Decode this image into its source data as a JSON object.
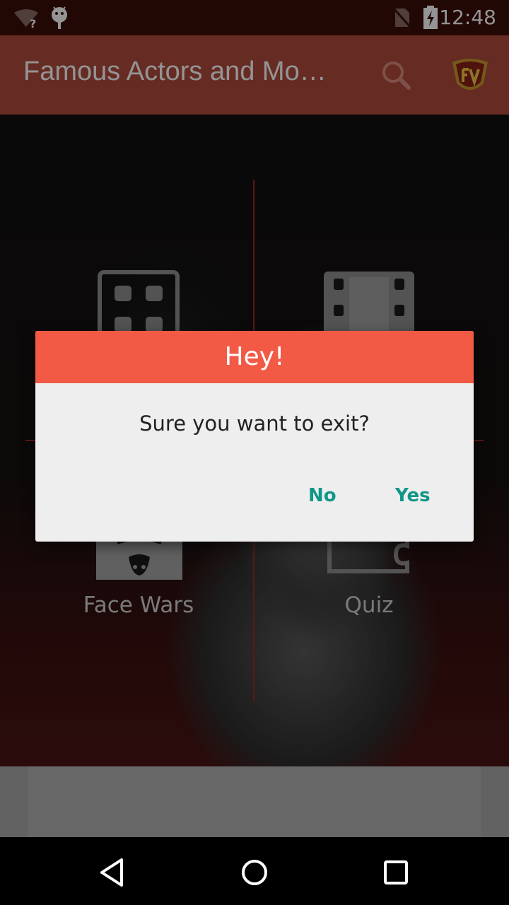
{
  "status_bar": {
    "time": "12:48",
    "icons": [
      "wifi-unknown-icon",
      "android-debug-icon",
      "no-sim-icon",
      "battery-charging-icon"
    ]
  },
  "app_bar": {
    "title": "Famous Actors and Mo…",
    "search_icon": "search-icon",
    "logo_icon": "fv-logo-icon"
  },
  "tiles": [
    {
      "label": "",
      "icon": "grid-dots-icon"
    },
    {
      "label": "",
      "icon": "film-strip-icon"
    },
    {
      "label": "Face Wars",
      "icon": "face-icon"
    },
    {
      "label": "Quiz",
      "icon": "puzzle-icon"
    }
  ],
  "dialog": {
    "title": "Hey!",
    "message": "Sure you want to exit?",
    "negative": "No",
    "positive": "Yes"
  },
  "nav_bar": {
    "icons": [
      "back-icon",
      "home-icon",
      "recents-icon"
    ]
  },
  "colors": {
    "status_bar": "#3c0e0a",
    "app_bar": "#b04a3b",
    "dialog_header": "#f25a45",
    "dialog_button": "#0f9688",
    "grid_lines": "#9c2a26"
  }
}
